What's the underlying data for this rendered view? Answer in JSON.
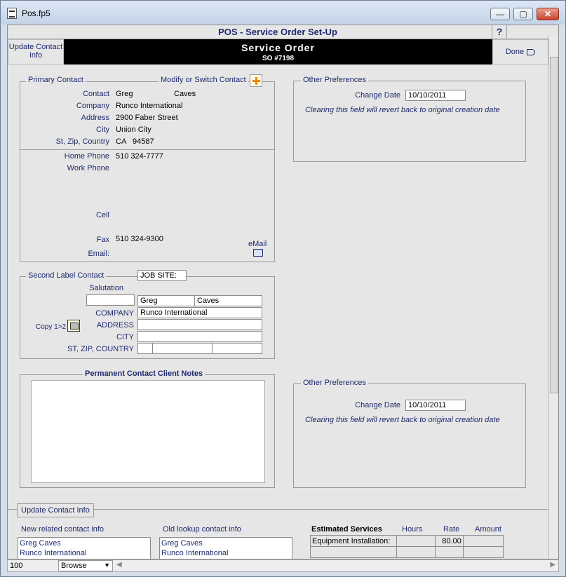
{
  "window": {
    "title": "Pos.fp5",
    "minimize": "—",
    "maximize": "▢",
    "close": "✕"
  },
  "header": {
    "title": "POS - Service Order Set-Up",
    "help": "?",
    "update_contact_info": "Update Contact Info",
    "main_title": "Service Order",
    "so_number": "SO #7198",
    "done": "Done"
  },
  "primary_contact": {
    "group_label": "Primary Contact",
    "modify_label": "Modify or Switch Contact",
    "contact_label": "Contact",
    "first_name": "Greg",
    "last_name": "Caves",
    "company_label": "Company",
    "company": "Runco International",
    "address_label": "Address",
    "address": "2900 Faber Street",
    "city_label": "City",
    "city": "Union City",
    "stzip_label": "St, Zip, Country",
    "state": "CA",
    "zip": "94587",
    "home_phone_label": "Home Phone",
    "home_phone": "510 324-7777",
    "work_phone_label": "Work Phone",
    "cell_label": "Cell",
    "fax_label": "Fax",
    "fax": "510 324-9300",
    "email_label": "Email:",
    "email_link": "eMail"
  },
  "other_prefs_top": {
    "group_label": "Other Preferences",
    "change_date_label": "Change Date",
    "change_date": "10/10/2011",
    "note": "Clearing this field will revert back to original creation date"
  },
  "second_label": {
    "group_label": "Second Label Contact",
    "job_site": "JOB SITE:",
    "salutation_label": "Salutation",
    "first_name": "Greg",
    "last_name": "Caves",
    "company_label": "COMPANY",
    "company": "Runco International",
    "address_label": "ADDRESS",
    "city_label": "CITY",
    "stzip_label": "ST, ZIP, COUNTRY",
    "copy_label": "Copy 1>2"
  },
  "notes": {
    "group_label": "Permanent Contact Client Notes"
  },
  "other_prefs_bottom": {
    "group_label": "Other Preferences",
    "change_date_label": "Change Date",
    "change_date": "10/10/2011",
    "note": "Clearing this field will revert back to original creation date"
  },
  "update_button": "Update Contact Info",
  "new_related": {
    "label": "New related contact info",
    "line1": "Greg Caves",
    "line2": "Runco International"
  },
  "old_lookup": {
    "label": "Old lookup contact info",
    "line1": "Greg Caves",
    "line2": "Runco International"
  },
  "estimated": {
    "title": "Estimated Services",
    "hours_label": "Hours",
    "rate_label": "Rate",
    "amount_label": "Amount",
    "row1_service": "Equipment Installation:",
    "row1_rate": "80.00"
  },
  "statusbar": {
    "zoom": "100",
    "mode": "Browse"
  }
}
